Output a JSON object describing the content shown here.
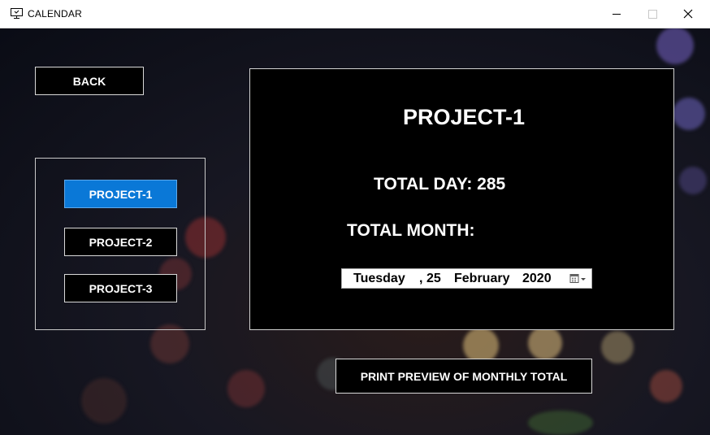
{
  "window": {
    "title": "CALENDAR"
  },
  "icons": {
    "app": "monitor-icon",
    "minimize": "minimize-icon",
    "maximize": "maximize-icon",
    "close": "close-icon",
    "calendar": "calendar-dropdown-icon"
  },
  "colors": {
    "selected_button": "#0a78d7",
    "panel_bg": "#000000",
    "text": "#ffffff"
  },
  "nav": {
    "back_label": "BACK"
  },
  "projects": [
    {
      "label": "PROJECT-1",
      "selected": true
    },
    {
      "label": "PROJECT-2",
      "selected": false
    },
    {
      "label": "PROJECT-3",
      "selected": false
    }
  ],
  "panel": {
    "title": "PROJECT-1",
    "total_day": "TOTAL DAY: 285",
    "total_month": "TOTAL MONTH:",
    "date": {
      "weekday": "Tuesday",
      "sep": ",",
      "day": "25",
      "month": "February",
      "year": "2020"
    }
  },
  "actions": {
    "print_preview_label": "PRINT PREVIEW OF MONTHLY TOTAL"
  }
}
